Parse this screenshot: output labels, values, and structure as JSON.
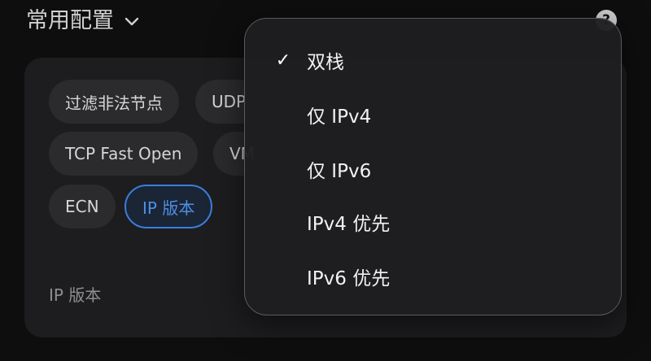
{
  "header": {
    "title": "常用配置",
    "help_glyph": "?"
  },
  "card": {
    "chips": [
      {
        "label": "过滤非法节点",
        "selected": false
      },
      {
        "label": "UDP",
        "selected": false
      },
      {
        "label": "TCP Fast Open",
        "selected": false
      },
      {
        "label": "VM",
        "selected": false
      },
      {
        "label": "ECN",
        "selected": false
      },
      {
        "label": "IP 版本",
        "selected": true
      }
    ],
    "section_label": "IP 版本"
  },
  "menu": {
    "items": [
      {
        "label": "双栈",
        "checked": true,
        "check_glyph": "✓"
      },
      {
        "label": "仅 IPv4",
        "checked": false
      },
      {
        "label": "仅 IPv6",
        "checked": false
      },
      {
        "label": "IPv4 优先",
        "checked": false
      },
      {
        "label": "IPv6 优先",
        "checked": false
      }
    ]
  },
  "colors": {
    "accent": "#3b7ddc",
    "background": "#0e0e0f",
    "card": "#1d1d1f",
    "chip": "#2b2b2e",
    "menu_border": "#5a5a5e"
  },
  "icons": {
    "header_toggle": "chevron-down-icon",
    "help": "help-icon",
    "checked_item": "checkmark-icon"
  }
}
